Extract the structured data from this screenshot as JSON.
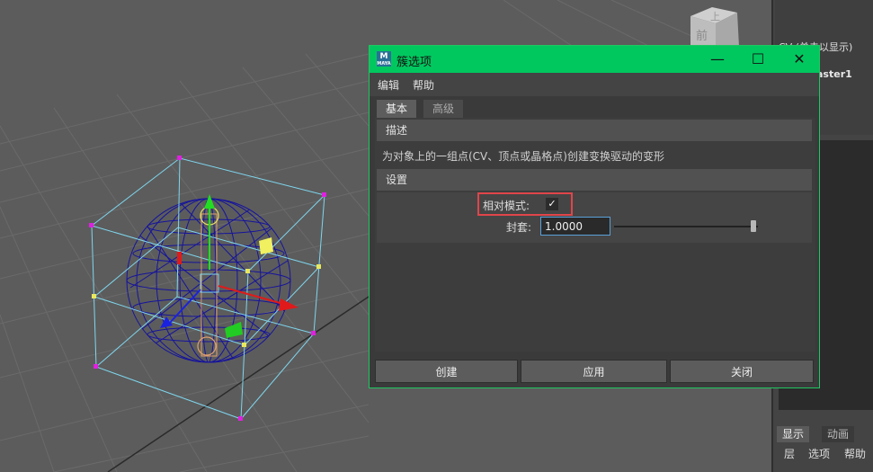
{
  "dialog": {
    "title": "簇选项",
    "app_icon_letter": "M",
    "app_icon_sub": "MAYA",
    "window_buttons": {
      "minimize": "—",
      "maximize": "☐",
      "close": "✕"
    },
    "menu": [
      "编辑",
      "帮助"
    ],
    "tabs": [
      "基本",
      "高级"
    ],
    "active_tab": "基本",
    "sections": {
      "description_header": "描述",
      "description_text": "为对象上的一组点(CV、顶点或晶格点)创建变换驱动的变形",
      "settings_header": "设置"
    },
    "relative_mode": {
      "label": "相对模式:",
      "checked": true,
      "check_glyph": "✓"
    },
    "envelope": {
      "label": "封套:",
      "value": "1.0000",
      "slider_fraction": 1.0
    },
    "buttons": {
      "create": "创建",
      "apply": "应用",
      "close": "关闭"
    },
    "accent_color": "#00c85f",
    "highlight_color": "#e0454a"
  },
  "viewcube": {
    "top_label": "上",
    "front_label": "前"
  },
  "right_panel": {
    "cv_text": "CV (单击以显示)",
    "node_name": "aster1",
    "tabs": [
      "显示",
      "动画"
    ],
    "menu": [
      "层",
      "选项",
      "帮助"
    ]
  }
}
